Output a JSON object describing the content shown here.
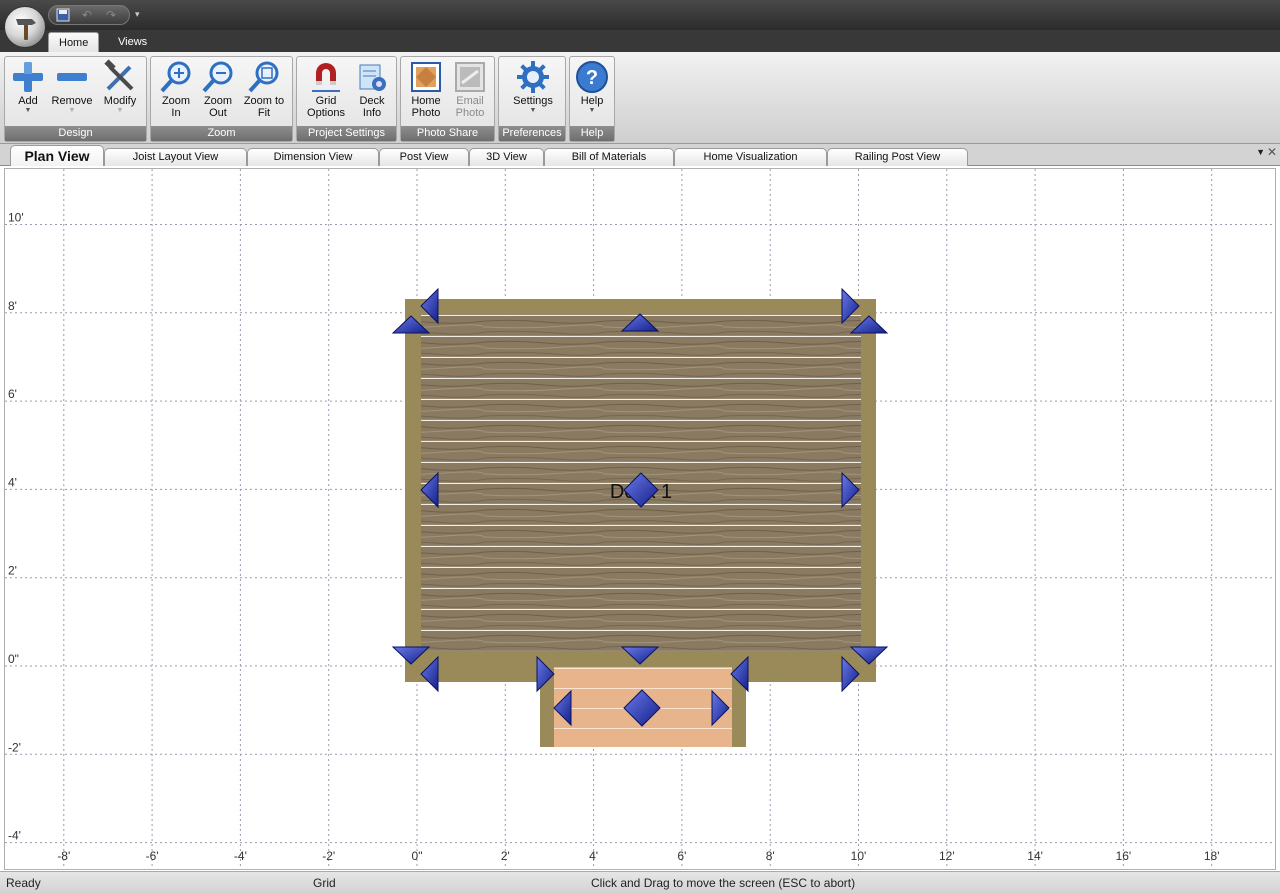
{
  "quick_access": {
    "save_icon": "save-icon",
    "undo_icon": "undo-icon",
    "redo_icon": "redo-icon",
    "more": "▾"
  },
  "ribbon_tabs": [
    {
      "label": "Home",
      "active": true
    },
    {
      "label": "Views",
      "active": false
    }
  ],
  "ribbon_groups": {
    "design": {
      "label": "Design",
      "buttons": [
        {
          "line1": "Add",
          "line2": "",
          "icon": "plus-icon",
          "dropdown": true
        },
        {
          "line1": "Remove",
          "line2": "",
          "icon": "minus-icon",
          "dropdown": true
        },
        {
          "line1": "Modify",
          "line2": "",
          "icon": "tools-icon",
          "dropdown": true
        }
      ]
    },
    "zoom": {
      "label": "Zoom",
      "buttons": [
        {
          "line1": "Zoom",
          "line2": "In",
          "icon": "zoom-in-icon"
        },
        {
          "line1": "Zoom",
          "line2": "Out",
          "icon": "zoom-out-icon"
        },
        {
          "line1": "Zoom to",
          "line2": "Fit",
          "icon": "zoom-fit-icon"
        }
      ]
    },
    "project": {
      "label": "Project Settings",
      "buttons": [
        {
          "line1": "Grid",
          "line2": "Options",
          "icon": "magnet-icon"
        },
        {
          "line1": "Deck",
          "line2": "Info",
          "icon": "deck-info-icon"
        }
      ]
    },
    "photo": {
      "label": "Photo Share",
      "buttons": [
        {
          "line1": "Home",
          "line2": "Photo",
          "icon": "home-photo-icon",
          "disabled": false
        },
        {
          "line1": "Email",
          "line2": "Photo",
          "icon": "email-photo-icon",
          "disabled": true
        }
      ]
    },
    "preferences": {
      "label": "Preferences",
      "buttons": [
        {
          "line1": "Settings",
          "line2": "",
          "icon": "gear-icon",
          "dropdown": true
        }
      ]
    },
    "help": {
      "label": "Help",
      "buttons": [
        {
          "line1": "Help",
          "line2": "",
          "icon": "help-icon",
          "dropdown": true
        }
      ]
    }
  },
  "doc_tabs": [
    {
      "label": "Plan View",
      "active": true
    },
    {
      "label": "Joist Layout View",
      "active": false
    },
    {
      "label": "Dimension View",
      "active": false
    },
    {
      "label": "Post View",
      "active": false
    },
    {
      "label": "3D View",
      "active": false
    },
    {
      "label": "Bill of Materials",
      "active": false
    },
    {
      "label": "Home Visualization",
      "active": false
    },
    {
      "label": "Railing Post View",
      "active": false
    }
  ],
  "doc_tab_controls": {
    "menu": "▼",
    "close": "✕"
  },
  "plan": {
    "x_axis_labels": [
      "-8'",
      "-6'",
      "-4'",
      "-2'",
      "0\"",
      "2'",
      "4'",
      "6'",
      "8'",
      "10'",
      "12'",
      "14'",
      "16'",
      "18'"
    ],
    "y_axis_labels": [
      "10'",
      "8'",
      "6'",
      "4'",
      "2'",
      "0\"",
      "-2'",
      "-4'"
    ],
    "deck_label": "Deck 1",
    "colors": {
      "grid": "#9a9ab0",
      "frame": "#9a8a5a",
      "wood": "#8a7a62",
      "stair": "#e8b48c",
      "handle": "#2a3aa8"
    }
  },
  "status": {
    "left": "Ready",
    "middle": "Grid",
    "right": "Click and Drag to move the screen  (ESC to abort)"
  }
}
